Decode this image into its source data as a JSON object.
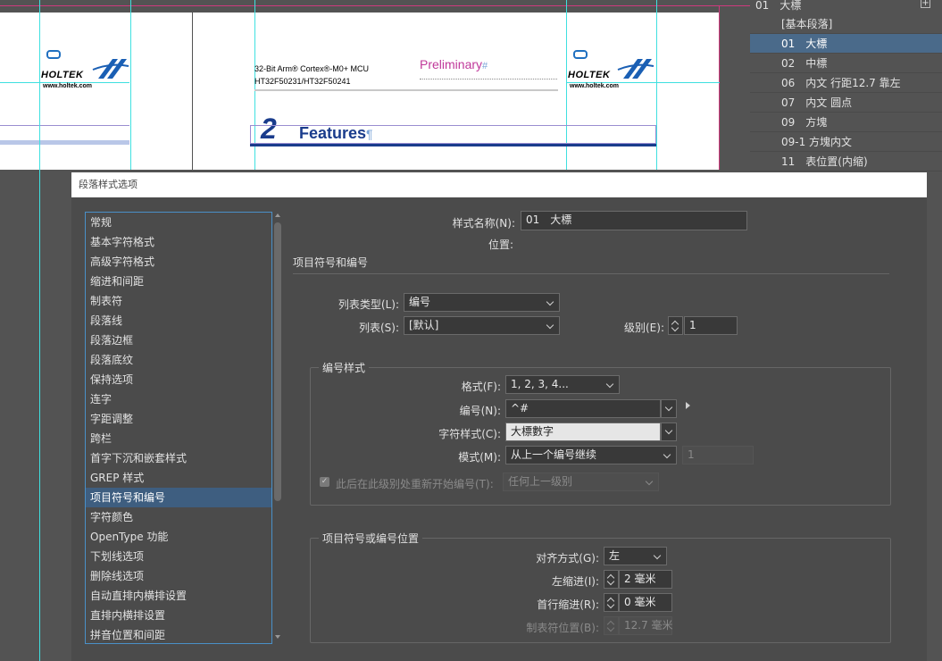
{
  "document": {
    "header_line1": "32-Bit Arm® Cortex®-M0+ MCU",
    "header_line2": "HT32F50231/HT32F50241",
    "preliminary": "Preliminary",
    "section_number": "2",
    "section_title": "Features",
    "logo_text": "HOLTEK",
    "logo_url": "www.holtek.com",
    "pilcrow": "¶",
    "hash": "#"
  },
  "styles_panel": {
    "top_item": "01　大標",
    "add_icon": "plus-square-icon",
    "items": [
      {
        "label": "[基本段落]"
      },
      {
        "label": "01　大標"
      },
      {
        "label": "02　中標"
      },
      {
        "label": "06　内文 行距12.7 靠左"
      },
      {
        "label": "07　内文 圆点"
      },
      {
        "label": "09　方塊"
      },
      {
        "label": "09-1 方塊内文"
      },
      {
        "label": "11　表位置(内缩)"
      }
    ],
    "selected_index": 1
  },
  "dialog": {
    "title": "段落样式选项",
    "categories": [
      "常规",
      "基本字符格式",
      "高级字符格式",
      "缩进和间距",
      "制表符",
      "段落线",
      "段落边框",
      "段落底纹",
      "保持选项",
      "连字",
      "字距调整",
      "跨栏",
      "首字下沉和嵌套样式",
      "GREP 样式",
      "项目符号和编号",
      "字符颜色",
      "OpenType 功能",
      "下划线选项",
      "删除线选项",
      "自动直排内横排设置",
      "直排内横排设置",
      "拼音位置和间距"
    ],
    "selected_category_index": 14,
    "style_name_label": "样式名称(N):",
    "style_name_value": "01　大標",
    "location_label": "位置:",
    "section_heading": "项目符号和编号",
    "list_type_label": "列表类型(L):",
    "list_type_value": "编号",
    "list_label": "列表(S):",
    "list_value": "[默认]",
    "level_label": "级别(E):",
    "level_value": "1",
    "numbering_style": {
      "title": "编号样式",
      "format_label": "格式(F):",
      "format_value": "1, 2, 3, 4...",
      "number_label": "编号(N):",
      "number_value": "^#",
      "char_style_label": "字符样式(C):",
      "char_style_value": "大標數字",
      "mode_label": "模式(M):",
      "mode_value": "从上一个编号继续",
      "mode_number": "1",
      "restart_label": "此后在此级别处重新开始编号(T):",
      "restart_checked": true,
      "restart_value": "任何上一级别"
    },
    "position": {
      "title": "项目符号或编号位置",
      "align_label": "对齐方式(G):",
      "align_value": "左",
      "left_indent_label": "左缩进(I):",
      "left_indent_value": "2 毫米",
      "first_indent_label": "首行缩进(R):",
      "first_indent_value": "0 毫米",
      "tab_pos_label": "制表符位置(B):",
      "tab_pos_value": "12.7 毫米"
    }
  }
}
